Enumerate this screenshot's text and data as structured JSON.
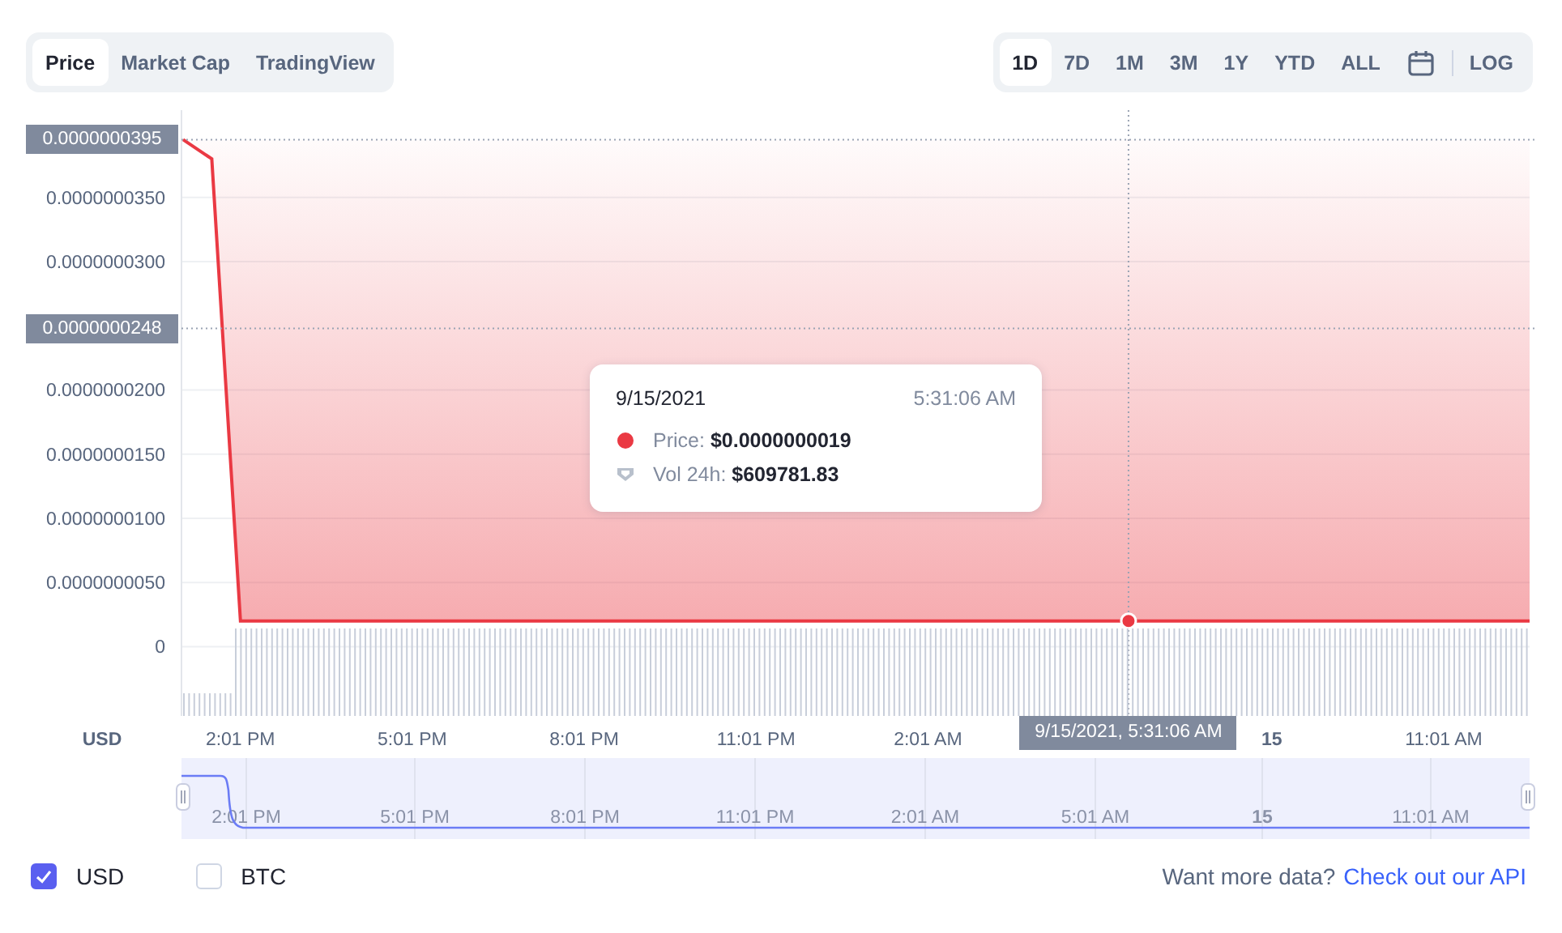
{
  "view_tabs": [
    {
      "label": "Price",
      "selected": true
    },
    {
      "label": "Market Cap",
      "selected": false
    },
    {
      "label": "TradingView",
      "selected": false
    }
  ],
  "ranges": [
    {
      "kind": "text",
      "label": "1D",
      "selected": true
    },
    {
      "kind": "text",
      "label": "7D",
      "selected": false
    },
    {
      "kind": "text",
      "label": "1M",
      "selected": false
    },
    {
      "kind": "text",
      "label": "3M",
      "selected": false
    },
    {
      "kind": "text",
      "label": "1Y",
      "selected": false
    },
    {
      "kind": "text",
      "label": "YTD",
      "selected": false
    },
    {
      "kind": "text",
      "label": "ALL",
      "selected": false
    },
    {
      "kind": "calendar",
      "selected": false
    },
    {
      "kind": "text",
      "label": "LOG",
      "selected": false
    }
  ],
  "chart": {
    "chart_data": {
      "type": "line",
      "grid": true,
      "categories": [
        null,
        null,
        "2:01 PM",
        null,
        null,
        null,
        null,
        null,
        "5:01 PM",
        null,
        null,
        null,
        null,
        null,
        "8:01 PM",
        null,
        null,
        null,
        null,
        null,
        "11:01 PM",
        null,
        null,
        null,
        null,
        null,
        "2:01 AM",
        null,
        null,
        null,
        null,
        null,
        null,
        null,
        null,
        null,
        null,
        null,
        "15",
        null,
        null,
        null,
        null,
        null,
        "11:01 AM",
        null,
        null,
        null
      ],
      "series": [
        {
          "color": "#ea3943",
          "values": [
            3.95e-08,
            3.8e-08,
            2e-09,
            2e-09,
            2e-09,
            2e-09,
            2e-09,
            2e-09,
            2e-09,
            2e-09,
            2e-09,
            2e-09,
            2e-09,
            2e-09,
            2e-09,
            2e-09,
            2e-09,
            2e-09,
            2e-09,
            2e-09,
            2e-09,
            2e-09,
            2e-09,
            2e-09,
            2e-09,
            2e-09,
            2e-09,
            2e-09,
            2e-09,
            2e-09,
            2e-09,
            2e-09,
            2e-09,
            2e-09,
            2e-09,
            2e-09,
            2e-09,
            2e-09,
            2e-09,
            2e-09,
            2e-09,
            2e-09,
            2e-09,
            2e-09,
            2e-09,
            2e-09,
            2e-09,
            2e-09
          ]
        }
      ],
      "ylim": [
        -5.4e-09,
        4.18e-08
      ],
      "yticks": [
        {
          "value": 3.5e-08,
          "label": "0.0000000350"
        },
        {
          "value": 3e-08,
          "label": "0.0000000300"
        },
        {
          "value": 2e-08,
          "label": "0.0000000200"
        },
        {
          "value": 1.5e-08,
          "label": "0.0000000150"
        },
        {
          "value": 1e-08,
          "label": "0.0000000100"
        },
        {
          "value": 5e-09,
          "label": "0.0000000050"
        },
        {
          "value": 0,
          "label": "0"
        }
      ]
    },
    "axis_currency": "USD",
    "x_label_styles": [
      {
        "bold": false
      },
      {
        "bold": false
      },
      {
        "bold": false
      },
      {
        "bold": false
      },
      {
        "bold": false
      },
      {
        "bold": true
      },
      {
        "bold": false
      }
    ],
    "start_price_label": "0.0000000395",
    "crosshair": {
      "price_label": "0.0000000248",
      "time_label": "9/15/2021, 5:31:06 AM"
    }
  },
  "tooltip": {
    "date": "9/15/2021",
    "time": "5:31:06 AM",
    "rows": [
      {
        "kind": "price",
        "label": "Price:",
        "value": "$0.0000000019"
      },
      {
        "kind": "volume",
        "label": "Vol 24h:",
        "value": "$609781.83"
      }
    ]
  },
  "navigator": {
    "labels": [
      {
        "label": "2:01 PM",
        "bold": false
      },
      {
        "label": "5:01 PM",
        "bold": false
      },
      {
        "label": "8:01 PM",
        "bold": false
      },
      {
        "label": "11:01 PM",
        "bold": false
      },
      {
        "label": "2:01 AM",
        "bold": false
      },
      {
        "label": "5:01 AM",
        "bold": false
      },
      {
        "label": "15",
        "bold": true
      },
      {
        "label": "11:01 AM",
        "bold": false
      }
    ]
  },
  "currencies": [
    {
      "label": "USD",
      "checked": true
    },
    {
      "label": "BTC",
      "checked": false
    }
  ],
  "footer": {
    "text": "Want more data?",
    "link": "Check out our API"
  }
}
